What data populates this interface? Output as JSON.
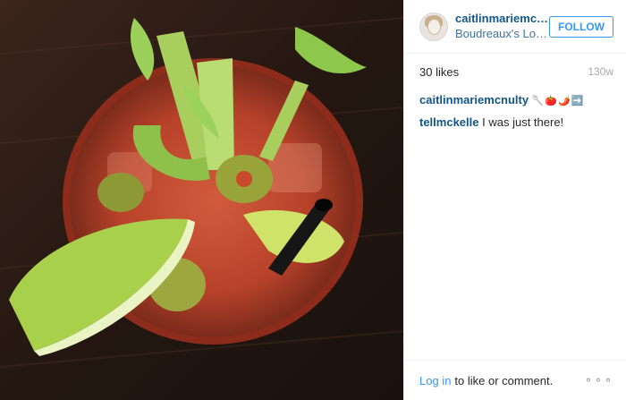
{
  "post": {
    "username": "caitlinmariemcnulty",
    "location": "Boudreaux's Louisi...",
    "follow_label": "FOLLOW",
    "likes": "30 likes",
    "age": "130w"
  },
  "comments": [
    {
      "user": "caitlinmariemcnulty",
      "text": "🥄🍅🌶️➡️"
    },
    {
      "user": "tellmckelle",
      "text": "I was just there!"
    }
  ],
  "footer": {
    "login_label": "Log in",
    "text": "to like or comment.",
    "more_icon": "more-options-icon"
  },
  "colors": {
    "link": "#125688",
    "accent": "#3897f0"
  }
}
